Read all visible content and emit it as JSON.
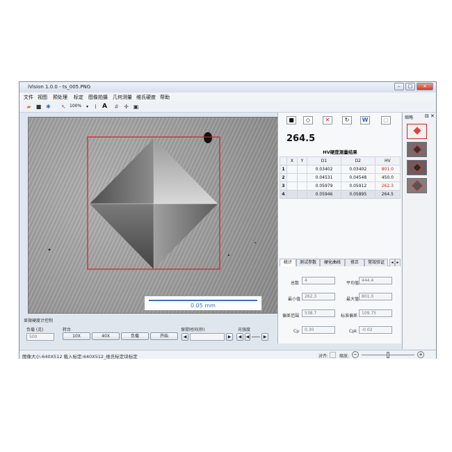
{
  "window": {
    "title": "iVision 1.0.0 - ts_005.PNG"
  },
  "menu": [
    "文件",
    "视图",
    "预处理",
    "标定",
    "图像拍摄",
    "几何测量",
    "维氏硬度",
    "帮助"
  ],
  "toolbar": {
    "zoom": "100%",
    "text_tool": "A"
  },
  "image": {
    "scale_label": "0.05 mm"
  },
  "controls": {
    "section_title": "显微硬度计控制",
    "load_label": "负载 (克)",
    "load_value": "500",
    "turret_label": "转台",
    "btn_10x": "10X",
    "btn_40x": "40X",
    "btn_load": "负载",
    "btn_start": "开始",
    "dwell_label": "保荷时间(秒)",
    "light_label": "光强度"
  },
  "status": {
    "text": "图像大小:640X512  载入标定:640X512_维氏标定块标定",
    "align_label": "对齐:",
    "zoom_label": "缩放:"
  },
  "results": {
    "hv_value": "264.5",
    "title": "HV硬度测量结果",
    "columns": [
      "",
      "X",
      "Y",
      "D1",
      "D2",
      "HV"
    ],
    "rows": [
      {
        "n": "1",
        "x": "",
        "y": "",
        "d1": "0.03402",
        "d2": "0.03402",
        "hv": "801.0",
        "hv_red": true
      },
      {
        "n": "2",
        "x": "",
        "y": "",
        "d1": "0.04531",
        "d2": "0.04548",
        "hv": "450.0",
        "hv_red": false
      },
      {
        "n": "3",
        "x": "",
        "y": "",
        "d1": "0.05979",
        "d2": "0.05912",
        "hv": "262.3",
        "hv_red": true
      },
      {
        "n": "4",
        "x": "",
        "y": "",
        "d1": "0.05946",
        "d2": "0.05895",
        "hv": "264.5",
        "hv_red": false
      }
    ]
  },
  "stats": {
    "tabs": [
      "统计",
      "测试参数",
      "硬化曲线",
      "修正",
      "常效验证"
    ],
    "count_label": "总数",
    "count": "4",
    "mean_label": "平均值",
    "mean": "444.4",
    "min_label": "最小值",
    "min": "262.3",
    "max_label": "最大值",
    "max": "801.0",
    "range_label": "偏差范围",
    "range": "538.7",
    "std_label": "标准偏差",
    "std": "109.75",
    "cp_label": "Cp",
    "cp": "0.30",
    "cpk_label": "Cpk",
    "cpk": "-0.02"
  },
  "thumbs": {
    "title": "缩略"
  },
  "colors": {
    "selection_rect": "#d42020",
    "scale_bar": "#3a6fc6",
    "hv_red": "#d21a1a"
  }
}
